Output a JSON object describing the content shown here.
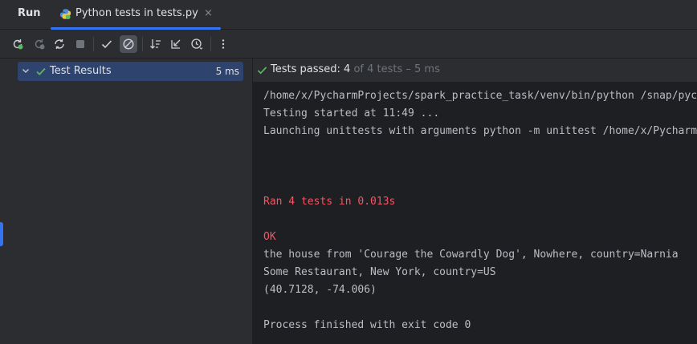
{
  "header": {
    "run_title": "Run",
    "tab_label": "Python tests in tests.py",
    "close_glyph": "×"
  },
  "toolbar": {
    "buttons": [
      {
        "icon": "rerun-icon"
      },
      {
        "icon": "rerun-failed-icon"
      },
      {
        "icon": "toggle-auto-test-icon"
      },
      {
        "icon": "stop-icon"
      },
      {
        "icon": "show-passed-icon"
      },
      {
        "icon": "show-ignored-icon"
      },
      {
        "icon": "sort-alphabetically-icon"
      },
      {
        "icon": "collapse-all-icon"
      },
      {
        "icon": "sort-by-duration-icon"
      },
      {
        "icon": "more-options-icon"
      }
    ]
  },
  "tree": {
    "root_label": "Test Results",
    "root_time": "5 ms"
  },
  "status": {
    "prefix": "Tests passed: ",
    "passed": "4",
    "suffix": " of 4 tests – 5 ms"
  },
  "console": {
    "lines": [
      {
        "text": "/home/x/PycharmProjects/spark_practice_task/venv/bin/python /snap/pycharm",
        "kind": "normal"
      },
      {
        "text": "Testing started at 11:49 ...",
        "kind": "normal"
      },
      {
        "text": "Launching unittests with arguments python -m unittest /home/x/PycharmProj",
        "kind": "normal"
      },
      {
        "text": "",
        "kind": "normal"
      },
      {
        "text": "",
        "kind": "normal"
      },
      {
        "text": "",
        "kind": "normal"
      },
      {
        "text": "Ran 4 tests in 0.013s",
        "kind": "err"
      },
      {
        "text": "",
        "kind": "normal"
      },
      {
        "text": "OK",
        "kind": "err"
      },
      {
        "text": "the house from 'Courage the Cowardly Dog', Nowhere, country=Narnia",
        "kind": "normal"
      },
      {
        "text": "Some Restaurant, New York, country=US",
        "kind": "normal"
      },
      {
        "text": "(40.7128, -74.006)",
        "kind": "normal"
      },
      {
        "text": "",
        "kind": "normal"
      },
      {
        "text": "Process finished with exit code 0",
        "kind": "normal"
      }
    ]
  },
  "colors": {
    "accent": "#3574f0",
    "pass_green": "#5fb865",
    "error_red": "#f75464",
    "selection": "#2e436e"
  }
}
